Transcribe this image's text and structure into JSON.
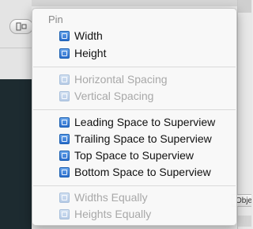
{
  "background": {
    "objects_tab": "Objects"
  },
  "menu": {
    "title": "Pin",
    "groups": [
      {
        "items": [
          {
            "label": "Width",
            "enabled": true,
            "icon": "width-pin-icon"
          },
          {
            "label": "Height",
            "enabled": true,
            "icon": "height-pin-icon"
          }
        ]
      },
      {
        "items": [
          {
            "label": "Horizontal Spacing",
            "enabled": false,
            "icon": "horizontal-spacing-icon"
          },
          {
            "label": "Vertical Spacing",
            "enabled": false,
            "icon": "vertical-spacing-icon"
          }
        ]
      },
      {
        "items": [
          {
            "label": "Leading Space to Superview",
            "enabled": true,
            "icon": "leading-space-icon"
          },
          {
            "label": "Trailing Space to Superview",
            "enabled": true,
            "icon": "trailing-space-icon"
          },
          {
            "label": "Top Space to Superview",
            "enabled": true,
            "icon": "top-space-icon"
          },
          {
            "label": "Bottom Space to Superview",
            "enabled": true,
            "icon": "bottom-space-icon"
          }
        ]
      },
      {
        "items": [
          {
            "label": "Widths Equally",
            "enabled": false,
            "icon": "widths-equally-icon"
          },
          {
            "label": "Heights Equally",
            "enabled": false,
            "icon": "heights-equally-icon"
          }
        ]
      }
    ]
  },
  "colors": {
    "icon_blue": "#2a6dcc",
    "disabled_text": "#a8a8a8"
  }
}
